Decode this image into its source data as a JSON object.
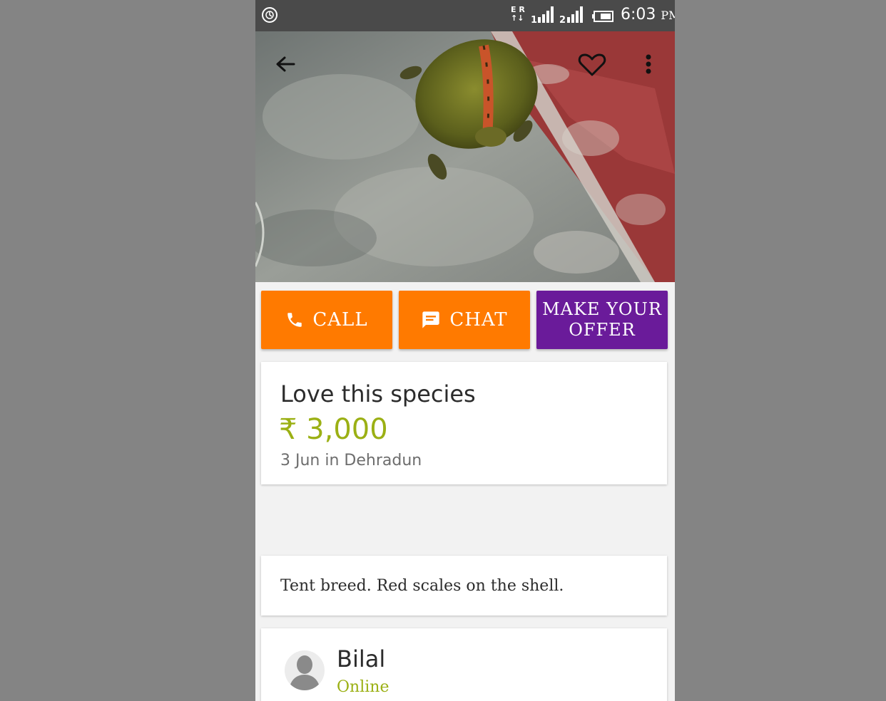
{
  "status_bar": {
    "network_letters": "E R",
    "sim1": "1",
    "sim2": "2",
    "time": "6:03",
    "ampm": "PM",
    "icons": [
      "app-notification-icon",
      "data-arrows-icon",
      "signal-icon",
      "signal-icon",
      "battery-icon"
    ]
  },
  "toolbar": {
    "icons": [
      "back-arrow-icon",
      "heart-icon",
      "more-vertical-icon"
    ]
  },
  "listing_photo": {
    "subject": "turtle on stone floor"
  },
  "actions": {
    "call_label": "CALL",
    "chat_label": "CHAT",
    "offer_label_line1": "MAKE YOUR",
    "offer_label_line2": "OFFER",
    "colors": {
      "call": "#ff7a00",
      "chat": "#ff7a00",
      "offer": "#6a1b9a"
    }
  },
  "listing": {
    "title": "Love this species",
    "price": "₹ 3,000",
    "meta": "3  Jun in Dehradun",
    "price_color": "#9bb014"
  },
  "description": {
    "text": "Tent breed. Red scales on the shell."
  },
  "seller": {
    "name": "Bilal",
    "status": "Online",
    "status_color": "#9bb014"
  }
}
